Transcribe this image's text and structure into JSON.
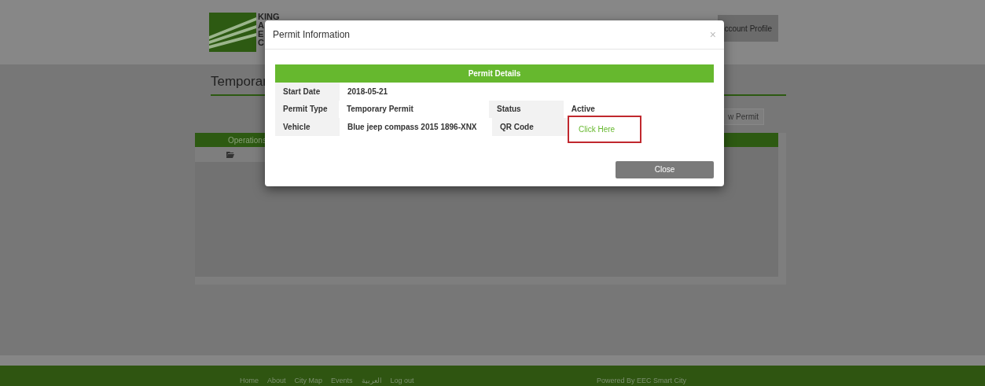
{
  "header": {
    "logo_lines": [
      "KING",
      "A",
      "E",
      "C"
    ],
    "account_button": "ccount Profile"
  },
  "page": {
    "title": "Temporar",
    "new_button": "w Permit",
    "table": {
      "columns": [
        "Operations"
      ]
    }
  },
  "modal": {
    "title": "Permit Information",
    "close_glyph": "×",
    "section_title": "Permit Details",
    "rows": [
      {
        "label": "Start Date",
        "value": "2018-05-21"
      },
      {
        "label": "Permit Type",
        "value": "Temporary Permit",
        "label_2": "Status",
        "value_2": "Active"
      },
      {
        "label": "Vehicle",
        "value": "Blue jeep compass 2015 1896-XNX",
        "label_2": "QR Code",
        "link": "Click Here",
        "highlighted": true
      }
    ],
    "close_button": "Close"
  },
  "footer": {
    "links": [
      "Home",
      "About",
      "City Map",
      "Events",
      "العربية",
      "Log out"
    ],
    "credit": "Powered By EEC Smart City"
  }
}
